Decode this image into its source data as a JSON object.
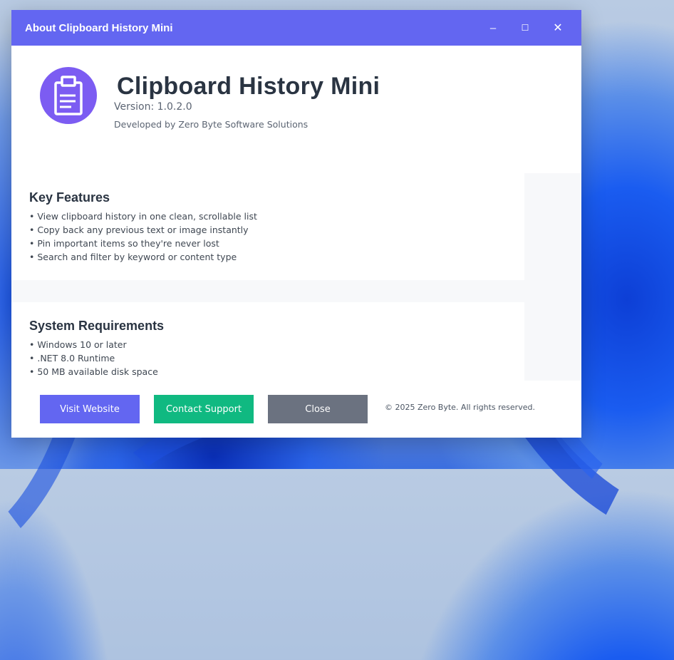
{
  "window": {
    "title": "About Clipboard History Mini",
    "controls": {
      "minimize": "–",
      "maximize": "☐",
      "close": "✕"
    },
    "accent_color": "#6366f1"
  },
  "app": {
    "name": "Clipboard History Mini",
    "version": "Version: 1.0.2.0",
    "developer": "Developed by Zero Byte Software Solutions",
    "logo_icon": "clipboard-icon",
    "logo_color": "#7c5cf2"
  },
  "features": {
    "title": "Key Features",
    "items": [
      "• View clipboard history in one clean, scrollable list",
      "• Copy back any previous text or image instantly",
      "• Pin important items so they're never lost",
      "• Search and filter by keyword or content type"
    ]
  },
  "requirements": {
    "title": "System Requirements",
    "items": [
      "• Windows 10 or later",
      "• .NET 8.0 Runtime",
      "• 50 MB available disk space"
    ]
  },
  "buttons": {
    "visit": {
      "label": "Visit Website",
      "color": "#6366f1"
    },
    "support": {
      "label": "Contact Support",
      "color": "#10b981"
    },
    "close": {
      "label": "Close",
      "color": "#6b7280"
    }
  },
  "footer": {
    "copyright": "© 2025 Zero Byte. All rights reserved."
  }
}
